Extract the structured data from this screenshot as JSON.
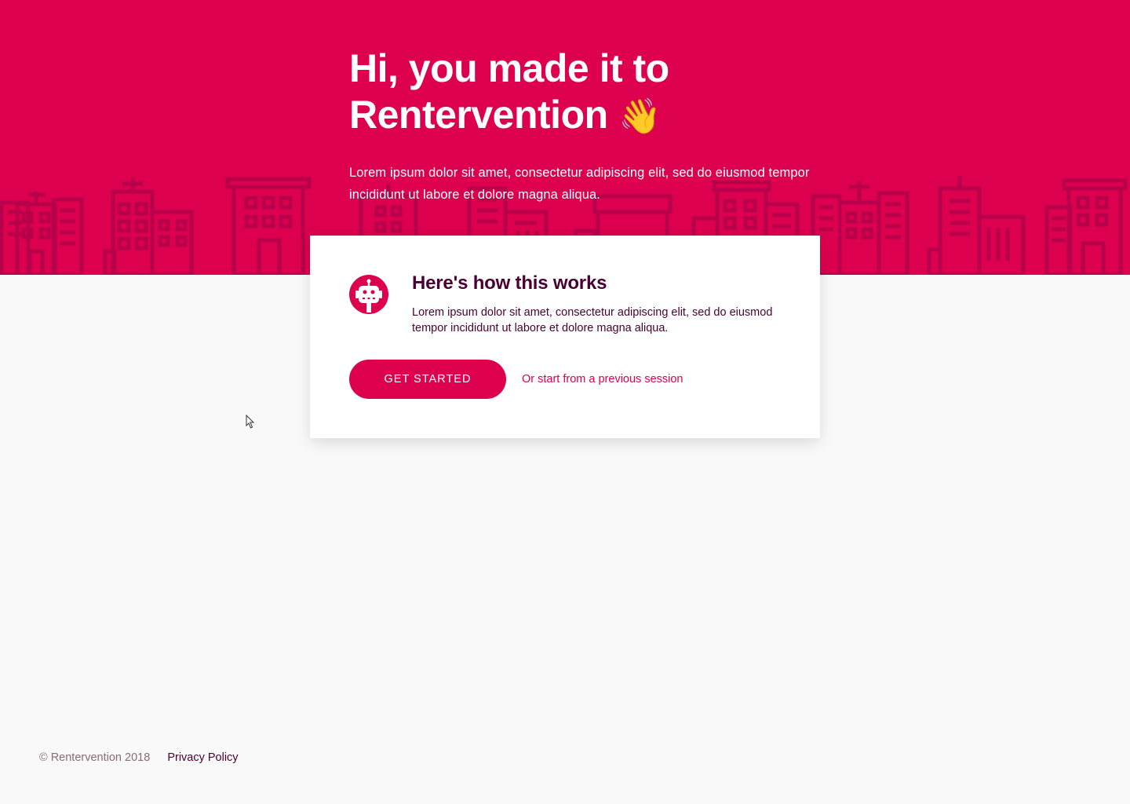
{
  "hero": {
    "title_line1": "Hi, you made it to",
    "title_line2": "Rentervention",
    "title_emoji": "👋",
    "subtitle": "Lorem ipsum dolor sit amet, consectetur adipiscing elit, sed do eiusmod tempor incididunt ut labore et dolore magna aliqua."
  },
  "card": {
    "icon": "robot-icon",
    "title": "Here's how this works",
    "text": "Lorem ipsum dolor sit amet, consectetur adipiscing elit, sed do eiusmod tempor incididunt ut labore et dolore magna aliqua.",
    "primary_button": "GET STARTED",
    "secondary_link": "Or start from a previous session"
  },
  "footer": {
    "copyright": "© Rentervention 2018",
    "privacy": "Privacy Policy"
  },
  "colors": {
    "brand": "#dc004e",
    "brand_dark_outline": "#b5004a",
    "heading_text": "#4a0030",
    "page_background": "#f9f9f9",
    "card_background": "#ffffff"
  }
}
